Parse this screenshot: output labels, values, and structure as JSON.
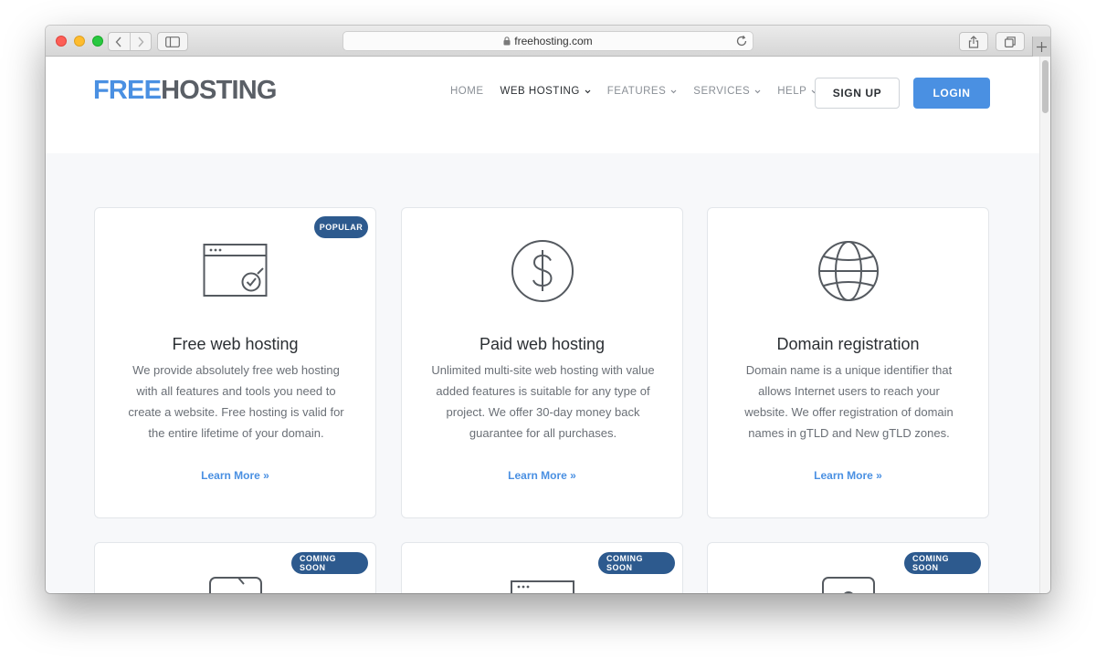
{
  "browser": {
    "url": "freehosting.com"
  },
  "header": {
    "logo_part1": "FREE",
    "logo_part2": "HOSTING",
    "nav": [
      {
        "label": "HOME"
      },
      {
        "label": "WEB HOSTING"
      },
      {
        "label": "FEATURES"
      },
      {
        "label": "SERVICES"
      },
      {
        "label": "HELP"
      }
    ],
    "signup_label": "SIGN UP",
    "login_label": "LOGIN"
  },
  "cards": [
    {
      "badge": "POPULAR",
      "icon": "browser-window-check-icon",
      "title": "Free web hosting",
      "description": "We provide absolutely free web hosting with all features and tools you need to create a website. Free hosting is valid for the entire lifetime of your domain.",
      "link": "Learn More »"
    },
    {
      "badge": "",
      "icon": "dollar-icon",
      "title": "Paid web hosting",
      "description": "Unlimited multi-site web hosting with value added features is suitable for any type of project. We offer 30-day money back guarantee for all purchases.",
      "link": "Learn More »"
    },
    {
      "badge": "",
      "icon": "globe-icon",
      "title": "Domain registration",
      "description": "Domain name is a unique identifier that allows Internet users to reach your website. We offer registration of domain names in gTLD and New gTLD zones.",
      "link": "Learn More »"
    },
    {
      "badge": "COMING SOON"
    },
    {
      "badge": "COMING SOON"
    },
    {
      "badge": "COMING SOON"
    }
  ],
  "colors": {
    "accent": "#4a90e2",
    "badge": "#2d5a8e",
    "logo_dark": "#5a5f66"
  }
}
